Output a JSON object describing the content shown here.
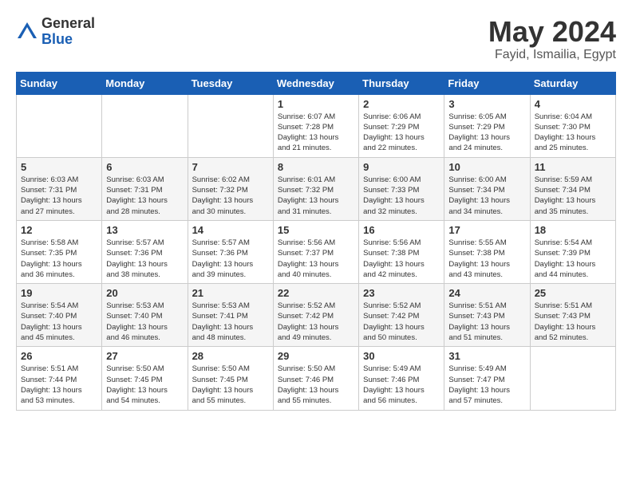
{
  "logo": {
    "general": "General",
    "blue": "Blue"
  },
  "title": "May 2024",
  "location": "Fayid, Ismailia, Egypt",
  "days_of_week": [
    "Sunday",
    "Monday",
    "Tuesday",
    "Wednesday",
    "Thursday",
    "Friday",
    "Saturday"
  ],
  "weeks": [
    [
      {
        "day": "",
        "info": ""
      },
      {
        "day": "",
        "info": ""
      },
      {
        "day": "",
        "info": ""
      },
      {
        "day": "1",
        "info": "Sunrise: 6:07 AM\nSunset: 7:28 PM\nDaylight: 13 hours\nand 21 minutes."
      },
      {
        "day": "2",
        "info": "Sunrise: 6:06 AM\nSunset: 7:29 PM\nDaylight: 13 hours\nand 22 minutes."
      },
      {
        "day": "3",
        "info": "Sunrise: 6:05 AM\nSunset: 7:29 PM\nDaylight: 13 hours\nand 24 minutes."
      },
      {
        "day": "4",
        "info": "Sunrise: 6:04 AM\nSunset: 7:30 PM\nDaylight: 13 hours\nand 25 minutes."
      }
    ],
    [
      {
        "day": "5",
        "info": "Sunrise: 6:03 AM\nSunset: 7:31 PM\nDaylight: 13 hours\nand 27 minutes."
      },
      {
        "day": "6",
        "info": "Sunrise: 6:03 AM\nSunset: 7:31 PM\nDaylight: 13 hours\nand 28 minutes."
      },
      {
        "day": "7",
        "info": "Sunrise: 6:02 AM\nSunset: 7:32 PM\nDaylight: 13 hours\nand 30 minutes."
      },
      {
        "day": "8",
        "info": "Sunrise: 6:01 AM\nSunset: 7:32 PM\nDaylight: 13 hours\nand 31 minutes."
      },
      {
        "day": "9",
        "info": "Sunrise: 6:00 AM\nSunset: 7:33 PM\nDaylight: 13 hours\nand 32 minutes."
      },
      {
        "day": "10",
        "info": "Sunrise: 6:00 AM\nSunset: 7:34 PM\nDaylight: 13 hours\nand 34 minutes."
      },
      {
        "day": "11",
        "info": "Sunrise: 5:59 AM\nSunset: 7:34 PM\nDaylight: 13 hours\nand 35 minutes."
      }
    ],
    [
      {
        "day": "12",
        "info": "Sunrise: 5:58 AM\nSunset: 7:35 PM\nDaylight: 13 hours\nand 36 minutes."
      },
      {
        "day": "13",
        "info": "Sunrise: 5:57 AM\nSunset: 7:36 PM\nDaylight: 13 hours\nand 38 minutes."
      },
      {
        "day": "14",
        "info": "Sunrise: 5:57 AM\nSunset: 7:36 PM\nDaylight: 13 hours\nand 39 minutes."
      },
      {
        "day": "15",
        "info": "Sunrise: 5:56 AM\nSunset: 7:37 PM\nDaylight: 13 hours\nand 40 minutes."
      },
      {
        "day": "16",
        "info": "Sunrise: 5:56 AM\nSunset: 7:38 PM\nDaylight: 13 hours\nand 42 minutes."
      },
      {
        "day": "17",
        "info": "Sunrise: 5:55 AM\nSunset: 7:38 PM\nDaylight: 13 hours\nand 43 minutes."
      },
      {
        "day": "18",
        "info": "Sunrise: 5:54 AM\nSunset: 7:39 PM\nDaylight: 13 hours\nand 44 minutes."
      }
    ],
    [
      {
        "day": "19",
        "info": "Sunrise: 5:54 AM\nSunset: 7:40 PM\nDaylight: 13 hours\nand 45 minutes."
      },
      {
        "day": "20",
        "info": "Sunrise: 5:53 AM\nSunset: 7:40 PM\nDaylight: 13 hours\nand 46 minutes."
      },
      {
        "day": "21",
        "info": "Sunrise: 5:53 AM\nSunset: 7:41 PM\nDaylight: 13 hours\nand 48 minutes."
      },
      {
        "day": "22",
        "info": "Sunrise: 5:52 AM\nSunset: 7:42 PM\nDaylight: 13 hours\nand 49 minutes."
      },
      {
        "day": "23",
        "info": "Sunrise: 5:52 AM\nSunset: 7:42 PM\nDaylight: 13 hours\nand 50 minutes."
      },
      {
        "day": "24",
        "info": "Sunrise: 5:51 AM\nSunset: 7:43 PM\nDaylight: 13 hours\nand 51 minutes."
      },
      {
        "day": "25",
        "info": "Sunrise: 5:51 AM\nSunset: 7:43 PM\nDaylight: 13 hours\nand 52 minutes."
      }
    ],
    [
      {
        "day": "26",
        "info": "Sunrise: 5:51 AM\nSunset: 7:44 PM\nDaylight: 13 hours\nand 53 minutes."
      },
      {
        "day": "27",
        "info": "Sunrise: 5:50 AM\nSunset: 7:45 PM\nDaylight: 13 hours\nand 54 minutes."
      },
      {
        "day": "28",
        "info": "Sunrise: 5:50 AM\nSunset: 7:45 PM\nDaylight: 13 hours\nand 55 minutes."
      },
      {
        "day": "29",
        "info": "Sunrise: 5:50 AM\nSunset: 7:46 PM\nDaylight: 13 hours\nand 55 minutes."
      },
      {
        "day": "30",
        "info": "Sunrise: 5:49 AM\nSunset: 7:46 PM\nDaylight: 13 hours\nand 56 minutes."
      },
      {
        "day": "31",
        "info": "Sunrise: 5:49 AM\nSunset: 7:47 PM\nDaylight: 13 hours\nand 57 minutes."
      },
      {
        "day": "",
        "info": ""
      }
    ]
  ]
}
